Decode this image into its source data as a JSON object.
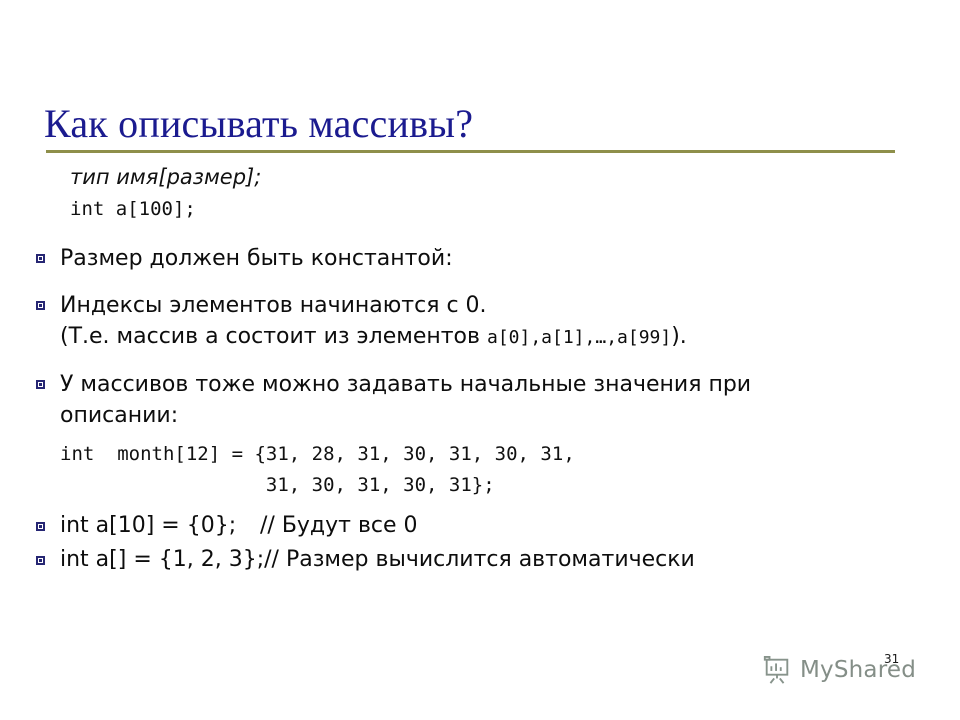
{
  "slide": {
    "title": "Как описывать массивы?",
    "accent_title_color": "#1b1b8f",
    "rule_color": "#8e8f4a",
    "bullet_marker_color": "#262673",
    "background_color": "#ffffff",
    "number": "31"
  },
  "intro": {
    "signature": "тип имя[размер];",
    "declaration": "int a[100];"
  },
  "bullets": [
    {
      "text": "Размер должен быть константой:"
    },
    {
      "line1": "Индексы элементов начинаются с 0.",
      "line2_pre": "(Т.е. массив a состоит из элементов ",
      "line2_code": "a[0],a[1],…,a[99]",
      "line2_post": ")."
    },
    {
      "line1": "У массивов тоже можно задавать начальные значения при",
      "line2": "описании:"
    },
    {
      "code": "int a[10] = {0};",
      "comment": "// Будут все 0"
    },
    {
      "code": "int a[] = {1, 2, 3};",
      "comment": "// Размер вычислится автоматически"
    }
  ],
  "code_block": {
    "line1": "int  month[12] = {31, 28, 31, 30, 31, 30, 31,",
    "line2": "                  31, 30, 31, 30, 31};"
  },
  "watermark": {
    "icon": "presentation-board-icon",
    "label": "MyShared"
  }
}
